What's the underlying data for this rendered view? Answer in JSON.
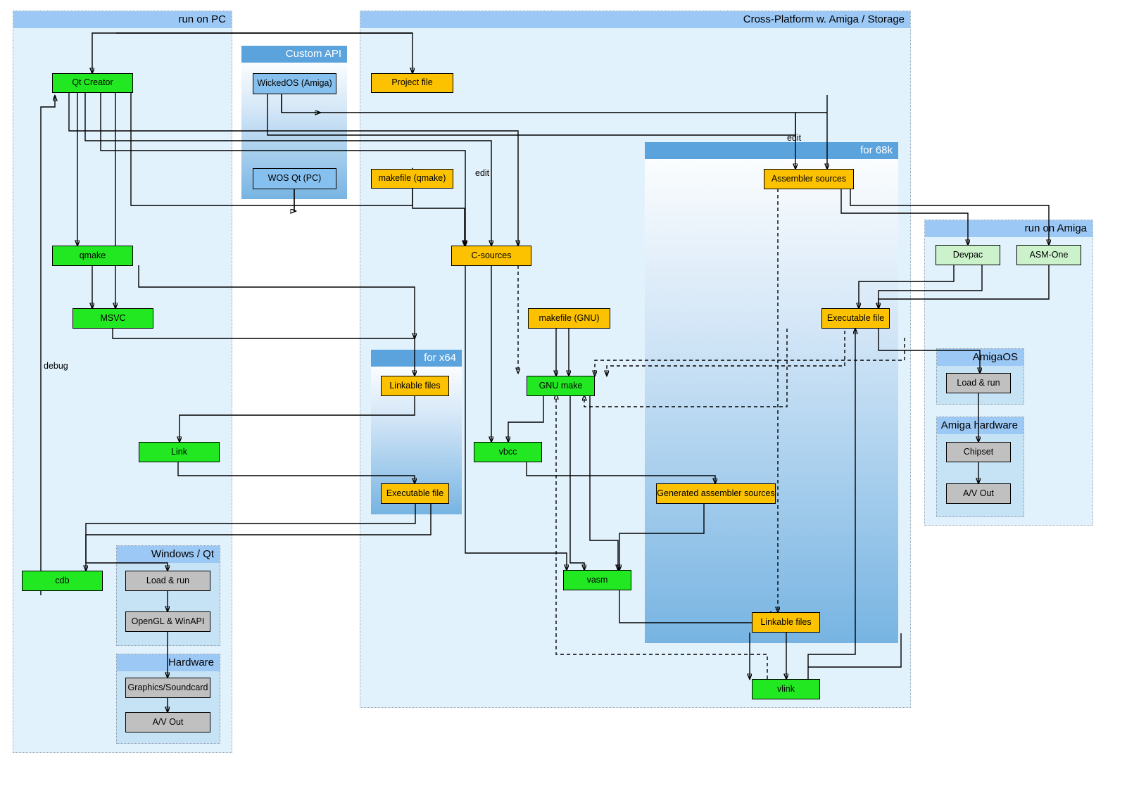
{
  "diagram": {
    "title": "Cross-platform Amiga / PC toolchain flowchart",
    "colors": {
      "lane_fill": "#e2f2fc",
      "lane_header": "#9cc8f5",
      "panel_header": "#5ba3dd",
      "tool_green": "#22e822",
      "file_orange": "#fcc200",
      "system_grey": "#c0c0c0",
      "amiga_green": "#ccf2cc",
      "api_blue": "#86c0ee"
    }
  },
  "lanes": {
    "run_on_pc": {
      "label": "run on PC"
    },
    "cross_platform": {
      "label": "Cross-Platform w. Amiga / Storage"
    },
    "run_on_amiga": {
      "label": "run on Amiga"
    }
  },
  "panels": {
    "custom_api": {
      "label": "Custom API"
    },
    "for_x64": {
      "label": "for x64"
    },
    "for_68k": {
      "label": "for 68k"
    }
  },
  "subgroups": {
    "windows_qt": {
      "label": "Windows / Qt"
    },
    "hardware": {
      "label": "Hardware"
    },
    "amigaos": {
      "label": "AmigaOS"
    },
    "amiga_hardware": {
      "label": "Amiga hardware"
    }
  },
  "nodes": {
    "qt_creator": {
      "label": "Qt Creator",
      "kind": "tool"
    },
    "wickedos": {
      "label": "WickedOS (Amiga)",
      "kind": "api"
    },
    "wos_qt_pc": {
      "label": "WOS Qt (PC)",
      "kind": "api"
    },
    "project_file": {
      "label": "Project file",
      "kind": "file"
    },
    "makefile_qmake": {
      "label": "makefile (qmake)",
      "kind": "file"
    },
    "c_sources": {
      "label": "C-sources",
      "kind": "file"
    },
    "assembler_sources": {
      "label": "Assembler sources",
      "kind": "file"
    },
    "qmake": {
      "label": "qmake",
      "kind": "tool"
    },
    "msvc": {
      "label": "MSVC",
      "kind": "tool"
    },
    "makefile_gnu": {
      "label": "makefile (GNU)",
      "kind": "file"
    },
    "devpac": {
      "label": "Devpac",
      "kind": "amiga-tool"
    },
    "asm_one": {
      "label": "ASM-One",
      "kind": "amiga-tool"
    },
    "executable_amiga": {
      "label": "Executable file",
      "kind": "file"
    },
    "linkable_x64": {
      "label": "Linkable files",
      "kind": "file"
    },
    "gnu_make": {
      "label": "GNU make",
      "kind": "tool"
    },
    "load_run_amiga": {
      "label": "Load & run",
      "kind": "system"
    },
    "link": {
      "label": "Link",
      "kind": "tool"
    },
    "vbcc": {
      "label": "vbcc",
      "kind": "tool"
    },
    "chipset": {
      "label": "Chipset",
      "kind": "system"
    },
    "executable_x64": {
      "label": "Executable file",
      "kind": "file"
    },
    "generated_asm": {
      "label": "Generated assembler sources",
      "kind": "file"
    },
    "av_out_amiga": {
      "label": "A/V Out",
      "kind": "system"
    },
    "cdb": {
      "label": "cdb",
      "kind": "tool"
    },
    "load_run_win": {
      "label": "Load & run",
      "kind": "system"
    },
    "vasm": {
      "label": "vasm",
      "kind": "tool"
    },
    "linkable_68k": {
      "label": "Linkable files",
      "kind": "file"
    },
    "opengl_winapi": {
      "label": "OpenGL & WinAPI",
      "kind": "system"
    },
    "vlink": {
      "label": "vlink",
      "kind": "tool"
    },
    "graphics_soundcard": {
      "label": "Graphics/Soundcard",
      "kind": "system"
    },
    "av_out_win": {
      "label": "A/V Out",
      "kind": "system"
    }
  },
  "edge_labels": {
    "edit_center": "edit",
    "edit_right": "edit",
    "debug": "debug"
  }
}
